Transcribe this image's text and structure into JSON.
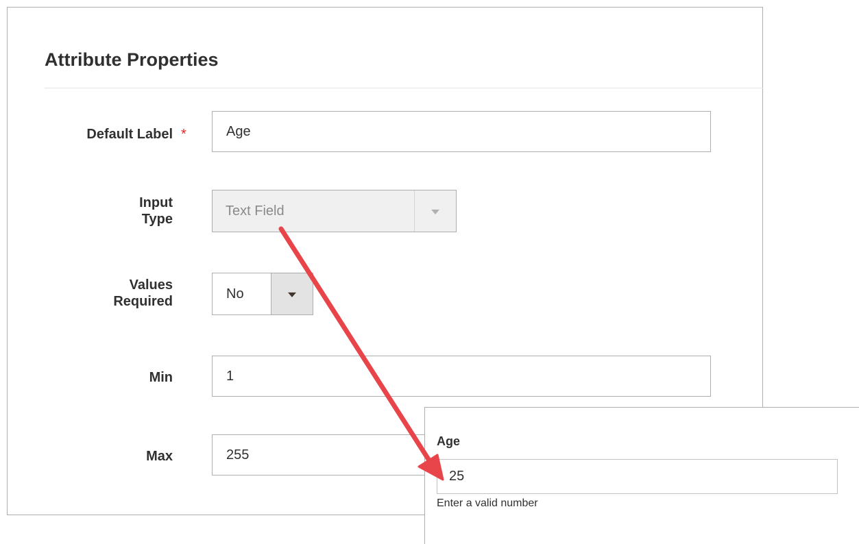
{
  "section": {
    "title": "Attribute Properties"
  },
  "fields": {
    "default_label": {
      "label": "Default Label",
      "required_marker": "*",
      "value": "Age"
    },
    "input_type": {
      "label_line1": "Input",
      "label_line2": "Type",
      "value": "Text Field",
      "disabled": true
    },
    "values_required": {
      "label_line1": "Values",
      "label_line2": "Required",
      "value": "No"
    },
    "min": {
      "label": "Min",
      "value": "1"
    },
    "max": {
      "label": "Max",
      "value": "255"
    }
  },
  "preview": {
    "label": "Age",
    "value": "25",
    "hint": "Enter a valid number"
  },
  "icons": {
    "select_arrow": "chevron-down-icon",
    "annotation": "red-arrow"
  },
  "colors": {
    "required_star": "#e22626",
    "annotation_arrow": "#e8454b",
    "disabled_bg": "#f0f0f0",
    "border": "#adadad"
  }
}
